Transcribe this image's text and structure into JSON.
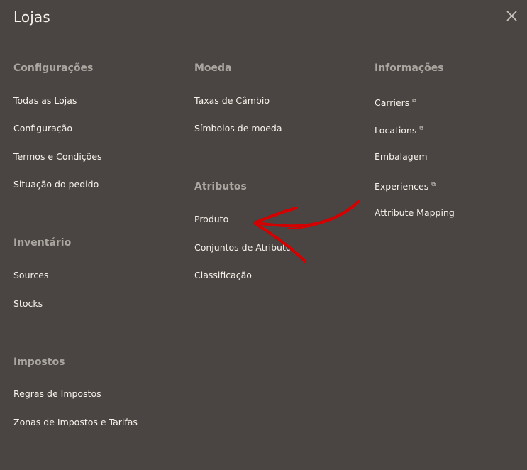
{
  "panel": {
    "title": "Lojas",
    "close_icon": "close-icon"
  },
  "columns": {
    "configuracoes": {
      "heading": "Configurações",
      "items": [
        "Todas as Lojas",
        "Configuração",
        "Termos e Condições",
        "Situação do pedido"
      ]
    },
    "inventario": {
      "heading": "Inventário",
      "items": [
        "Sources",
        "Stocks"
      ]
    },
    "impostos": {
      "heading": "Impostos",
      "items": [
        "Regras de Impostos",
        "Zonas de Impostos e Tarifas"
      ]
    },
    "moeda": {
      "heading": "Moeda",
      "items": [
        "Taxas de Câmbio",
        "Símbolos de moeda"
      ]
    },
    "atributos": {
      "heading": "Atributos",
      "items": [
        "Produto",
        "Conjuntos de Atributo",
        "Classificação"
      ]
    },
    "informacoes": {
      "heading": "Informações",
      "items": [
        "Carriers",
        "Locations",
        "Embalagem",
        "Experiences",
        "Attribute Mapping"
      ],
      "external_link_icon": "external-link-icon"
    }
  },
  "annotation": {
    "arrow_color": "#d40000"
  }
}
